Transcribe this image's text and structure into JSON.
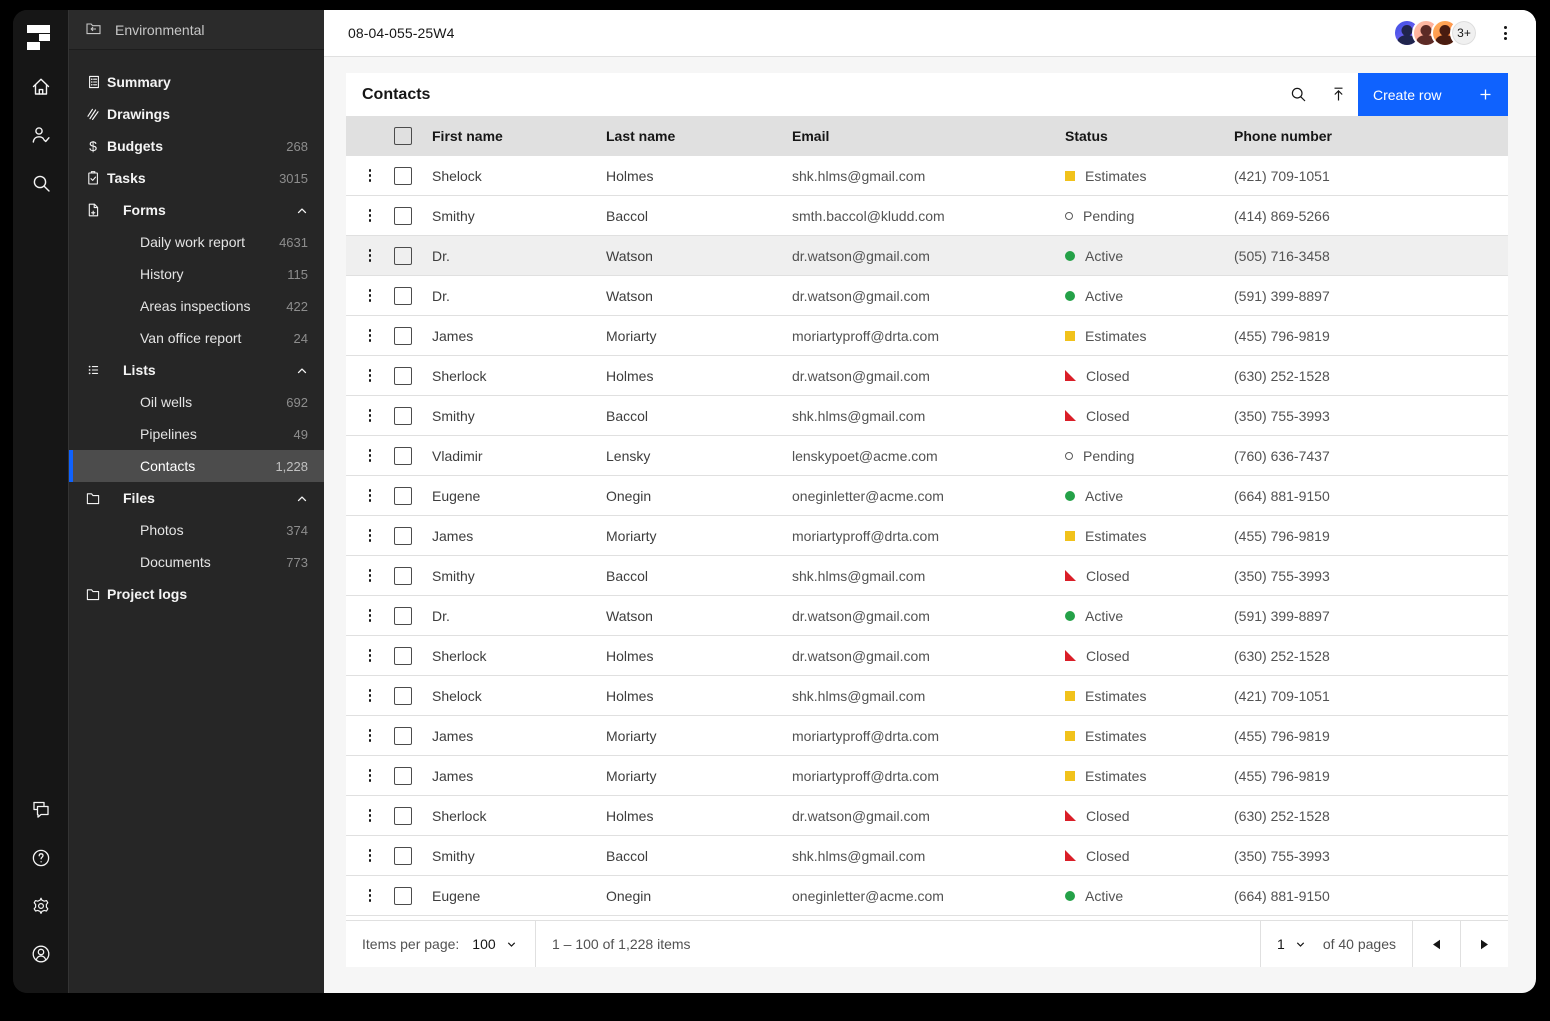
{
  "rail": {
    "icons_top": [
      "home-icon",
      "user-follow-icon",
      "search-icon"
    ],
    "icons_bottom": [
      "forum-icon",
      "help-icon",
      "settings-icon",
      "account-icon"
    ]
  },
  "sidebar": {
    "project": {
      "label": "Environmental",
      "icon": "folder-parent-icon"
    },
    "items": [
      {
        "type": "item",
        "icon": "summary-icon",
        "label": "Summary"
      },
      {
        "type": "item",
        "icon": "drawings-icon",
        "label": "Drawings"
      },
      {
        "type": "item",
        "icon": "dollar-icon",
        "label": "Budgets",
        "count": "268"
      },
      {
        "type": "item",
        "icon": "tasks-icon",
        "label": "Tasks",
        "count": "3015"
      },
      {
        "type": "group",
        "icon": "forms-icon",
        "label": "Forms",
        "chevron": "up"
      },
      {
        "type": "sub",
        "label": "Daily work report",
        "count": "4631"
      },
      {
        "type": "sub",
        "label": "History",
        "count": "115"
      },
      {
        "type": "sub",
        "label": "Areas inspections",
        "count": "422"
      },
      {
        "type": "sub",
        "label": "Van office report",
        "count": "24"
      },
      {
        "type": "group",
        "icon": "lists-icon",
        "label": "Lists",
        "chevron": "up"
      },
      {
        "type": "sub",
        "label": "Oil wells",
        "count": "692"
      },
      {
        "type": "sub",
        "label": "Pipelines",
        "count": "49"
      },
      {
        "type": "sub",
        "label": "Contacts",
        "count": "1,228",
        "selected": true
      },
      {
        "type": "group",
        "icon": "folder-icon",
        "label": "Files",
        "chevron": "up"
      },
      {
        "type": "sub",
        "label": "Photos",
        "count": "374"
      },
      {
        "type": "sub",
        "label": "Documents",
        "count": "773"
      },
      {
        "type": "item",
        "icon": "folder-icon",
        "label": "Project logs"
      }
    ]
  },
  "topbar": {
    "title": "08-04-055-25W4",
    "avatars_overflow": "3+"
  },
  "table": {
    "title": "Contacts",
    "create_button_label": "Create row",
    "headers": [
      "First name",
      "Last name",
      "Email",
      "Status",
      "Phone number"
    ],
    "status_colors": {
      "Estimates": "#f1c21b",
      "Pending": "#5a5a5a",
      "Active": "#24a148",
      "Closed": "#da1e28"
    },
    "rows": [
      {
        "first": "Shelock",
        "last": "Holmes",
        "email": "shk.hlms@gmail.com",
        "status": "Estimates",
        "phone": "(421) 709-1051"
      },
      {
        "first": "Smithy",
        "last": "Baccol",
        "email": "smth.baccol@kludd.com",
        "status": "Pending",
        "phone": "(414) 869-5266"
      },
      {
        "first": "Dr.",
        "last": "Watson",
        "email": "dr.watson@gmail.com",
        "status": "Active",
        "phone": "(505) 716-3458",
        "highlighted": true
      },
      {
        "first": "Dr.",
        "last": "Watson",
        "email": "dr.watson@gmail.com",
        "status": "Active",
        "phone": "(591) 399-8897"
      },
      {
        "first": "James",
        "last": "Moriarty",
        "email": "moriartyproff@drta.com",
        "status": "Estimates",
        "phone": "(455) 796-9819"
      },
      {
        "first": "Sherlock",
        "last": "Holmes",
        "email": "dr.watson@gmail.com",
        "status": "Closed",
        "phone": "(630) 252-1528"
      },
      {
        "first": "Smithy",
        "last": "Baccol",
        "email": "shk.hlms@gmail.com",
        "status": "Closed",
        "phone": "(350) 755-3993"
      },
      {
        "first": "Vladimir",
        "last": "Lensky",
        "email": "lenskypoet@acme.com",
        "status": "Pending",
        "phone": "(760) 636-7437"
      },
      {
        "first": "Eugene",
        "last": "Onegin",
        "email": "oneginletter@acme.com",
        "status": "Active",
        "phone": "(664) 881-9150"
      },
      {
        "first": "James",
        "last": "Moriarty",
        "email": "moriartyproff@drta.com",
        "status": "Estimates",
        "phone": "(455) 796-9819"
      },
      {
        "first": "Smithy",
        "last": "Baccol",
        "email": "shk.hlms@gmail.com",
        "status": "Closed",
        "phone": "(350) 755-3993"
      },
      {
        "first": "Dr.",
        "last": "Watson",
        "email": "dr.watson@gmail.com",
        "status": "Active",
        "phone": "(591) 399-8897"
      },
      {
        "first": "Sherlock",
        "last": "Holmes",
        "email": "dr.watson@gmail.com",
        "status": "Closed",
        "phone": "(630) 252-1528"
      },
      {
        "first": "Shelock",
        "last": "Holmes",
        "email": "shk.hlms@gmail.com",
        "status": "Estimates",
        "phone": "(421) 709-1051"
      },
      {
        "first": "James",
        "last": "Moriarty",
        "email": "moriartyproff@drta.com",
        "status": "Estimates",
        "phone": "(455) 796-9819"
      },
      {
        "first": "James",
        "last": "Moriarty",
        "email": "moriartyproff@drta.com",
        "status": "Estimates",
        "phone": "(455) 796-9819"
      },
      {
        "first": "Sherlock",
        "last": "Holmes",
        "email": "dr.watson@gmail.com",
        "status": "Closed",
        "phone": "(630) 252-1528"
      },
      {
        "first": "Smithy",
        "last": "Baccol",
        "email": "shk.hlms@gmail.com",
        "status": "Closed",
        "phone": "(350) 755-3993"
      },
      {
        "first": "Eugene",
        "last": "Onegin",
        "email": "oneginletter@acme.com",
        "status": "Active",
        "phone": "(664) 881-9150"
      }
    ]
  },
  "pagination": {
    "items_per_page_label": "Items per page:",
    "items_per_page_value": "100",
    "range_text": "1 – 100 of 1,228 items",
    "page_value": "1",
    "pages_text": "of 40 pages"
  },
  "colors": {
    "accent_blue": "#0f62fe",
    "header_gray": "#e0e0e0",
    "rail_bg": "#161616",
    "sidebar_bg": "#262626"
  }
}
